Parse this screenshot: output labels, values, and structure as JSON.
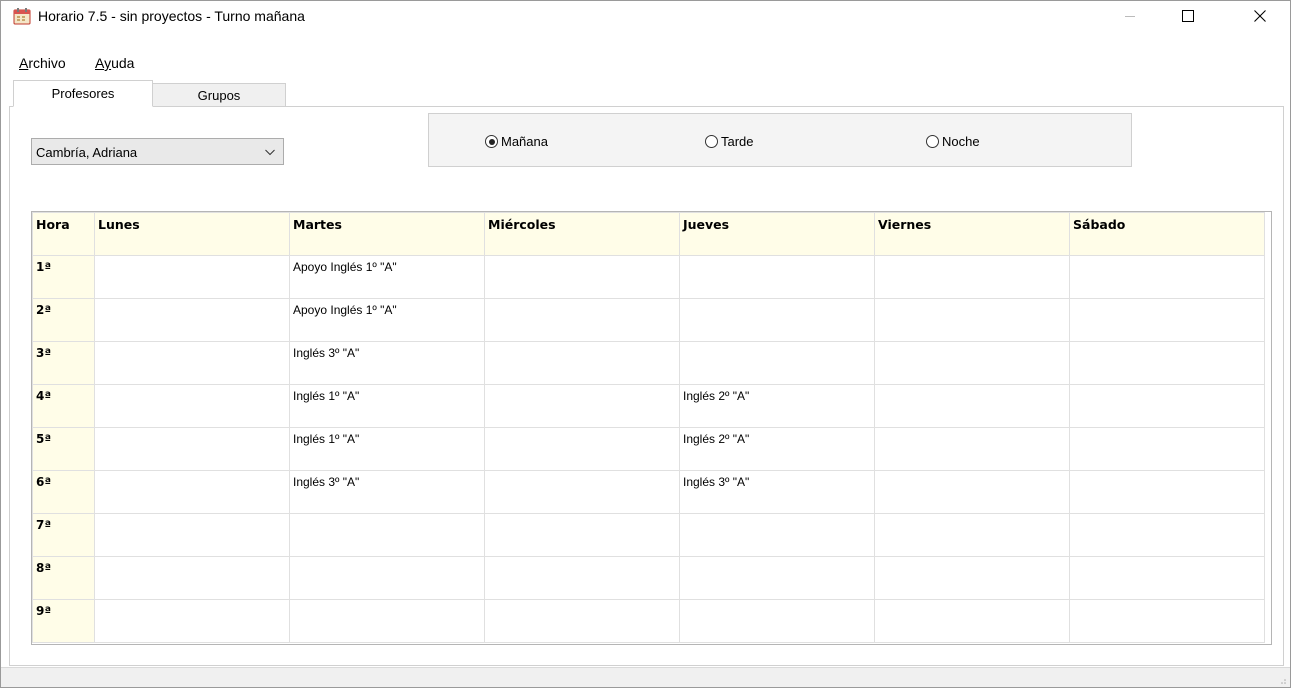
{
  "window": {
    "title": "Horario 7.5 - sin proyectos - Turno mañana",
    "icon": "calendar-icon"
  },
  "menu": {
    "archivo": "Archivo",
    "ayuda_prefix": "A",
    "ayuda_u": "y",
    "ayuda_rest": "uda"
  },
  "tabs": {
    "profesores": "Profesores",
    "grupos": "Grupos"
  },
  "teacher_select": {
    "value": "Cambría, Adriana"
  },
  "shift": {
    "options": [
      "Mañana",
      "Tarde",
      "Noche"
    ],
    "selected": "Mañana"
  },
  "schedule": {
    "columns": [
      "Hora",
      "Lunes",
      "Martes",
      "Miércoles",
      "Jueves",
      "Viernes",
      "Sábado"
    ],
    "rows": [
      {
        "hour": "1ª",
        "cells": [
          "",
          "Apoyo Inglés 1º \"A\"",
          "",
          "",
          "",
          ""
        ]
      },
      {
        "hour": "2ª",
        "cells": [
          "",
          "Apoyo Inglés 1º \"A\"",
          "",
          "",
          "",
          ""
        ]
      },
      {
        "hour": "3ª",
        "cells": [
          "",
          "Inglés 3º \"A\"",
          "",
          "",
          "",
          ""
        ]
      },
      {
        "hour": "4ª",
        "cells": [
          "",
          "Inglés 1º \"A\"",
          "",
          "Inglés 2º \"A\"",
          "",
          ""
        ]
      },
      {
        "hour": "5ª",
        "cells": [
          "",
          "Inglés 1º \"A\"",
          "",
          "Inglés 2º \"A\"",
          "",
          ""
        ]
      },
      {
        "hour": "6ª",
        "cells": [
          "",
          "Inglés 3º \"A\"",
          "",
          "Inglés 3º \"A\"",
          "",
          ""
        ]
      },
      {
        "hour": "7ª",
        "cells": [
          "",
          "",
          "",
          "",
          "",
          ""
        ]
      },
      {
        "hour": "8ª",
        "cells": [
          "",
          "",
          "",
          "",
          "",
          ""
        ]
      },
      {
        "hour": "9ª",
        "cells": [
          "",
          "",
          "",
          "",
          "",
          ""
        ]
      }
    ]
  }
}
